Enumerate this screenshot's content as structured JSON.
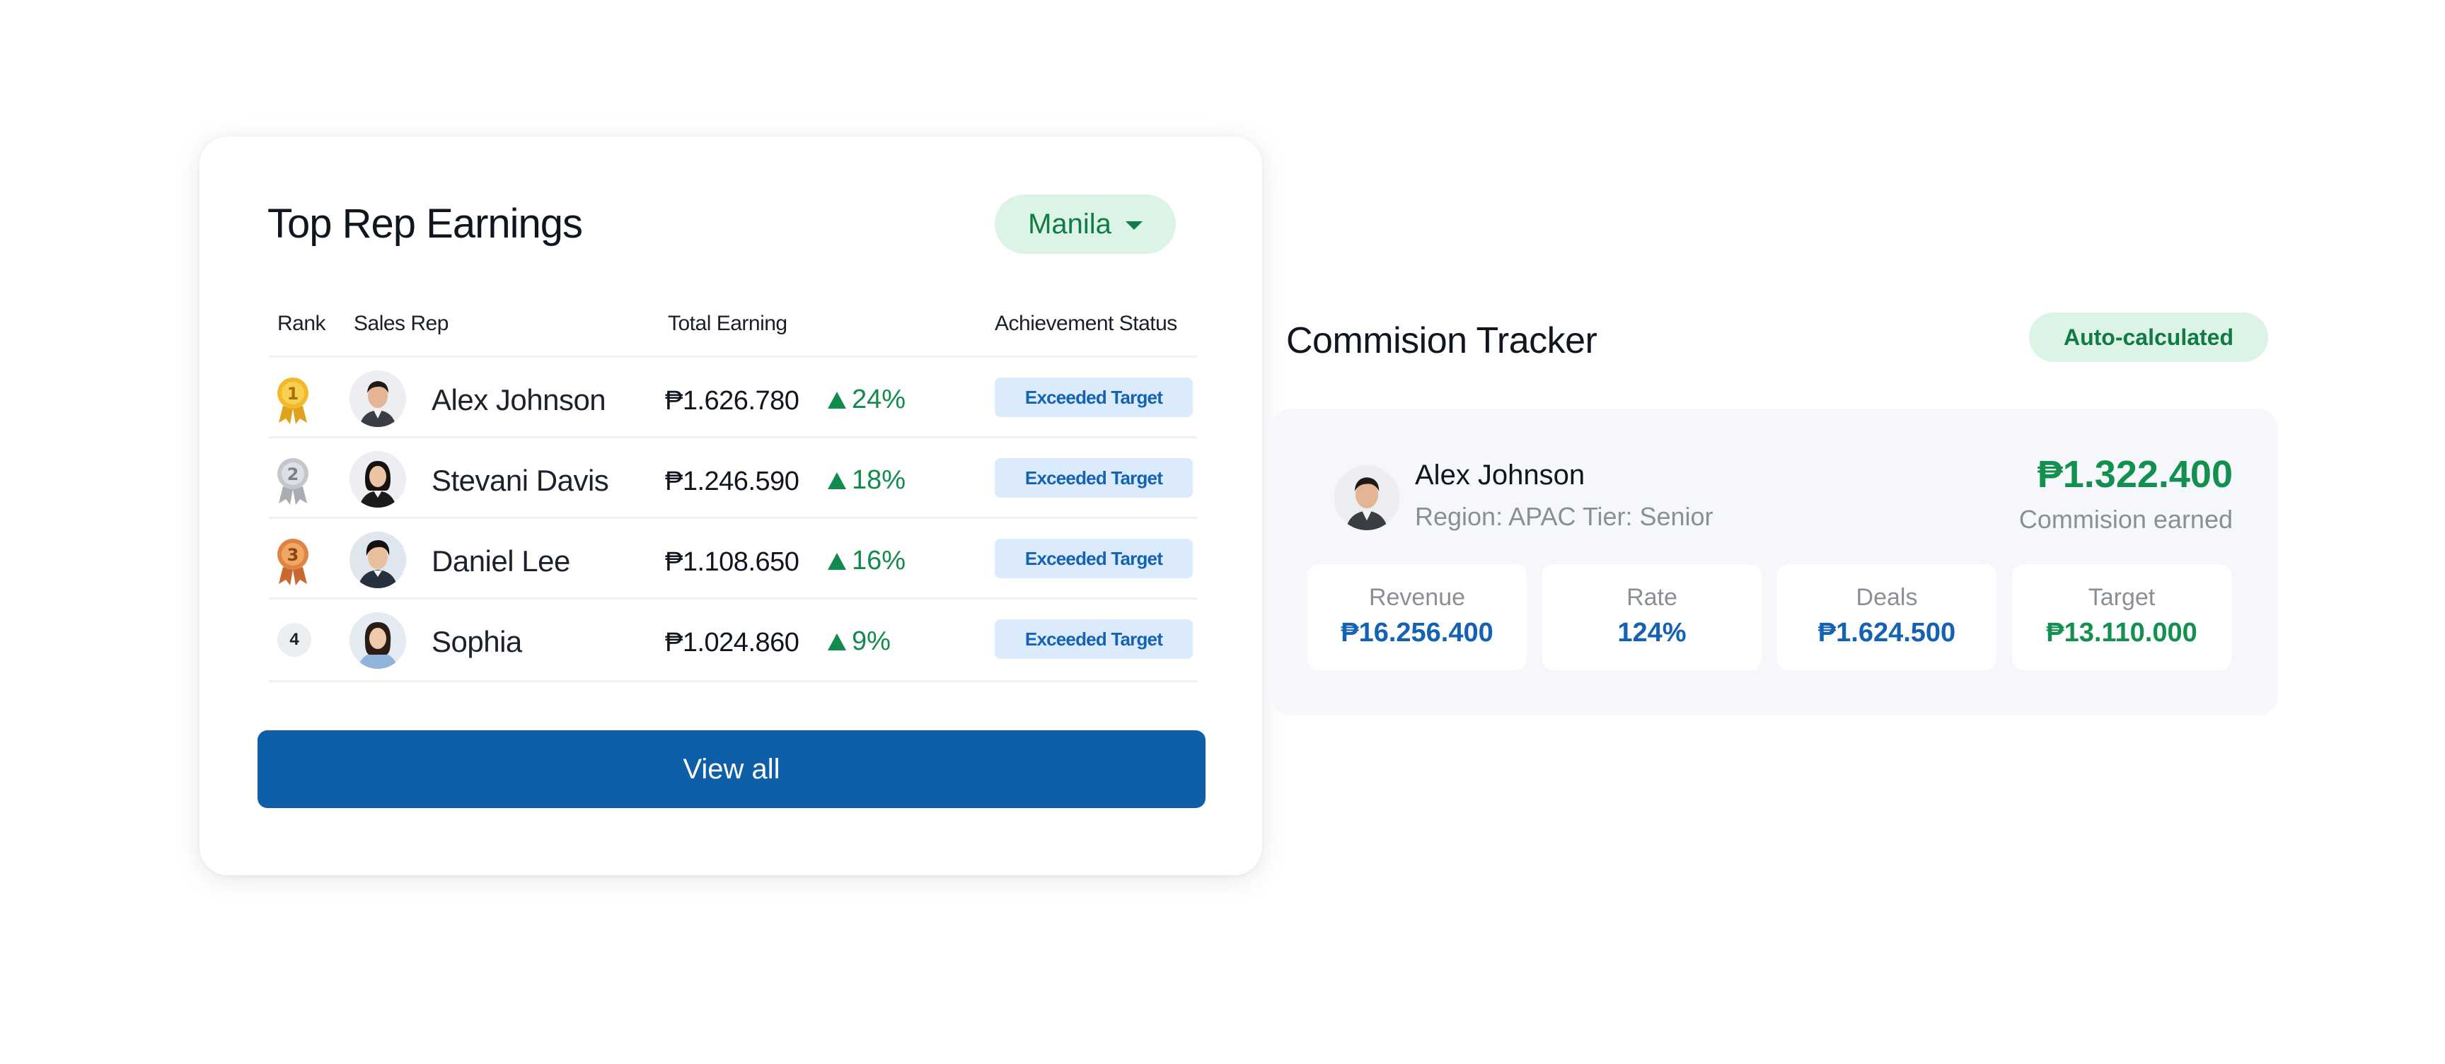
{
  "top_reps": {
    "title": "Top Rep Earnings",
    "city_filter": {
      "selected": "Manila",
      "icon": "chevron-down-icon"
    },
    "columns": {
      "rank": "Rank",
      "sales_rep": "Sales Rep",
      "total_earning": "Total Earning",
      "achievement_status": "Achievement Status"
    },
    "rows": [
      {
        "rank": "1",
        "rank_icon": "gold-medal-icon",
        "name": "Alex Johnson",
        "earning": "₱1.626.780",
        "growth": "24%",
        "status": "Exceeded Target"
      },
      {
        "rank": "2",
        "rank_icon": "silver-medal-icon",
        "name": "Stevani Davis",
        "earning": "₱1.246.590",
        "growth": "18%",
        "status": "Exceeded Target"
      },
      {
        "rank": "3",
        "rank_icon": "bronze-medal-icon",
        "name": "Daniel Lee",
        "earning": "₱1.108.650",
        "growth": "16%",
        "status": "Exceeded Target"
      },
      {
        "rank": "4",
        "rank_icon": "",
        "name": "Sophia",
        "earning": "₱1.024.860",
        "growth": "9%",
        "status": "Exceeded Target"
      }
    ],
    "view_all_label": "View all"
  },
  "commission_tracker": {
    "title": "Commision Tracker",
    "badge": "Auto-calculated",
    "rep_name": "Alex Johnson",
    "rep_detail": "Region: APAC Tier: Senior",
    "commission_amount": "₱1.322.400",
    "commission_label": "Commision earned",
    "stats": [
      {
        "label": "Revenue",
        "value": "₱16.256.400"
      },
      {
        "label": "Rate",
        "value": "124%"
      },
      {
        "label": "Deals",
        "value": "₱1.624.500"
      },
      {
        "label": "Target",
        "value": "₱13.110.000"
      }
    ]
  },
  "colors": {
    "accent_green": "#139050",
    "accent_blue": "#1462b4",
    "primary_button": "#0e5ea8",
    "badge_green_bg": "#dcf4e6",
    "badge_blue_bg": "#dcebfb"
  }
}
